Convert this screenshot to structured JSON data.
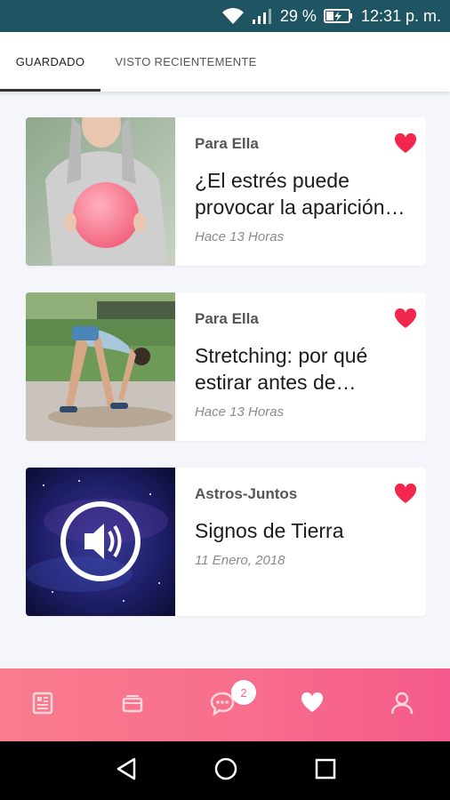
{
  "status_bar": {
    "battery": "29 %",
    "time": "12:31 p. m.",
    "icons": [
      "wifi-icon",
      "signal-icon",
      "battery-charging-icon"
    ]
  },
  "tabs": [
    {
      "label": "GUARDADO",
      "active": true
    },
    {
      "label": "VISTO RECIENTEMENTE",
      "active": false
    }
  ],
  "articles": [
    {
      "category": "Para Ella",
      "title": "¿El estrés puede provocar la aparición…",
      "time": "Hace 13 Horas",
      "image": "woman-with-pink-ball",
      "favorited": true
    },
    {
      "category": "Para Ella",
      "title": "Stretching: por qué estirar antes de…",
      "time": "Hace 13 Horas",
      "image": "woman-stretching",
      "favorited": true
    },
    {
      "category": "Astros-Juntos",
      "title": "Signos de Tierra",
      "time": "11 Enero, 2018",
      "image": "audio-starfield",
      "favorited": true
    }
  ],
  "bottom_nav": {
    "items": [
      "news-icon",
      "wallet-icon",
      "chat-icon",
      "heart-icon",
      "profile-icon"
    ],
    "active": "heart-icon",
    "chat_badge": "2"
  },
  "system_nav": [
    "back-icon",
    "home-icon",
    "recents-icon"
  ],
  "colors": {
    "status_bar": "#1f5563",
    "accent_heart": "#f2274d",
    "nav_gradient_start": "#f97c8d",
    "nav_gradient_end": "#f45a8b"
  }
}
